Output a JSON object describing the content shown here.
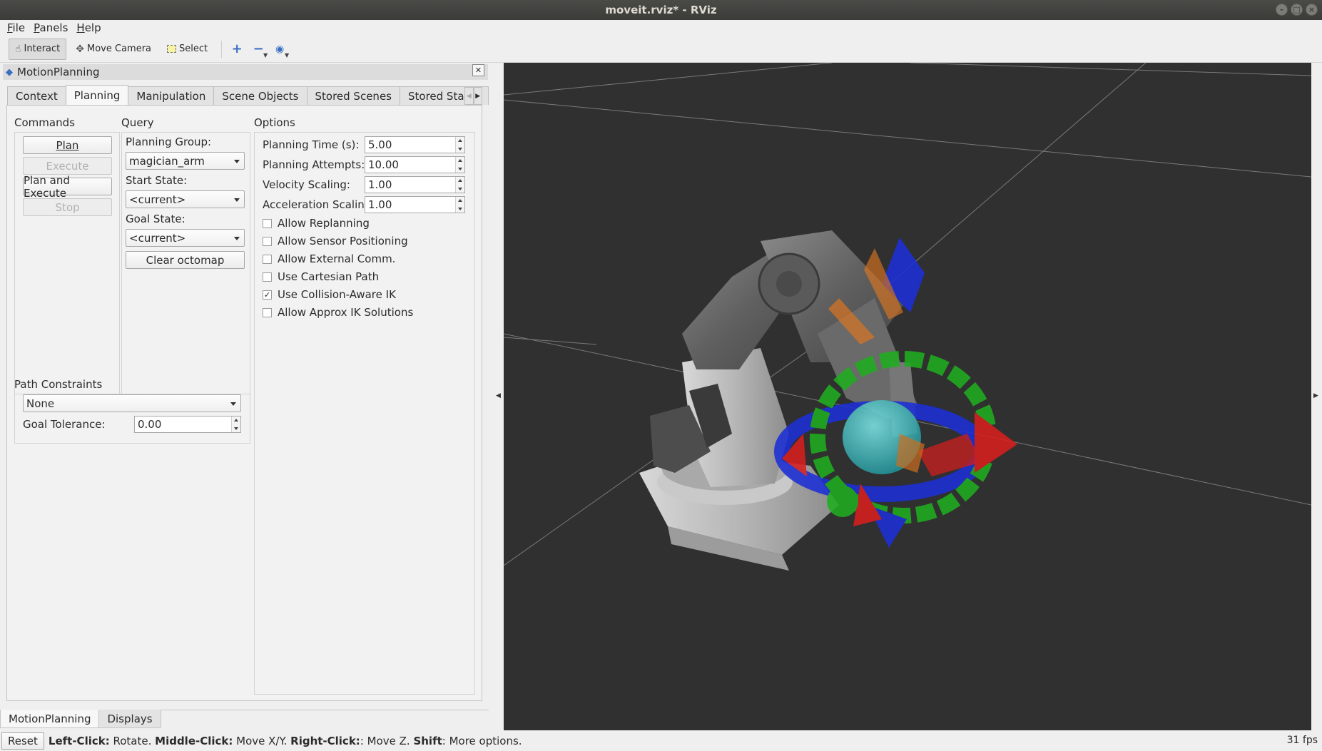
{
  "window": {
    "title": "moveit.rviz* - RViz",
    "buttons": [
      "–",
      "□",
      "×"
    ]
  },
  "menu": {
    "items": [
      {
        "first": "F",
        "rest": "ile"
      },
      {
        "first": "P",
        "rest": "anels"
      },
      {
        "first": "H",
        "rest": "elp"
      }
    ]
  },
  "toolbar": {
    "interact": "Interact",
    "move_camera": "Move Camera",
    "select": "Select",
    "icons": [
      "plus-icon",
      "minus-icon",
      "eye-icon"
    ]
  },
  "panel": {
    "title": "MotionPlanning",
    "tabs": [
      "Context",
      "Planning",
      "Manipulation",
      "Scene Objects",
      "Stored Scenes",
      "Stored States"
    ],
    "selected_tab": "Planning",
    "commands": {
      "label": "Commands",
      "plan": "Plan",
      "execute": "Execute",
      "plan_execute": "Plan and Execute",
      "stop": "Stop"
    },
    "query": {
      "label": "Query",
      "planning_group_label": "Planning Group:",
      "planning_group_value": "magician_arm",
      "start_state_label": "Start State:",
      "start_state_value": "<current>",
      "goal_state_label": "Goal State:",
      "goal_state_value": "<current>",
      "clear_octomap": "Clear octomap"
    },
    "options": {
      "label": "Options",
      "planning_time_label": "Planning Time (s):",
      "planning_time_value": "5.00",
      "planning_attempts_label": "Planning Attempts:",
      "planning_attempts_value": "10.00",
      "velocity_label": "Velocity Scaling:",
      "velocity_value": "1.00",
      "accel_label": "Acceleration Scaling:",
      "accel_value": "1.00",
      "checkboxes": [
        {
          "label": "Allow Replanning",
          "checked": false
        },
        {
          "label": "Allow Sensor Positioning",
          "checked": false
        },
        {
          "label": "Allow External Comm.",
          "checked": false
        },
        {
          "label": "Use Cartesian Path",
          "checked": false
        },
        {
          "label": "Use Collision-Aware IK",
          "checked": true
        },
        {
          "label": "Allow Approx IK Solutions",
          "checked": false
        }
      ]
    },
    "path_constraints": {
      "label": "Path Constraints",
      "value": "None",
      "goal_tolerance_label": "Goal Tolerance:",
      "goal_tolerance_value": "0.00"
    }
  },
  "bottom_tabs": [
    "MotionPlanning",
    "Displays"
  ],
  "status": {
    "reset": "Reset",
    "parts": [
      {
        "bold": "Left-Click:",
        "text": " Rotate. "
      },
      {
        "bold": "Middle-Click:",
        "text": " Move X/Y. "
      },
      {
        "bold": "Right-Click:",
        "text": ": Move Z. "
      },
      {
        "bold": "Shift",
        "text": ": More options."
      }
    ],
    "fps": "31 fps"
  },
  "colors": {
    "viewport_bg": "#303030",
    "grid": "#8a8a8a",
    "marker_red": "#d81e1e",
    "marker_green": "#1fae1f",
    "marker_blue": "#1c2fd6",
    "marker_cyan": "#31c7c7",
    "marker_orange": "#e2761c"
  }
}
